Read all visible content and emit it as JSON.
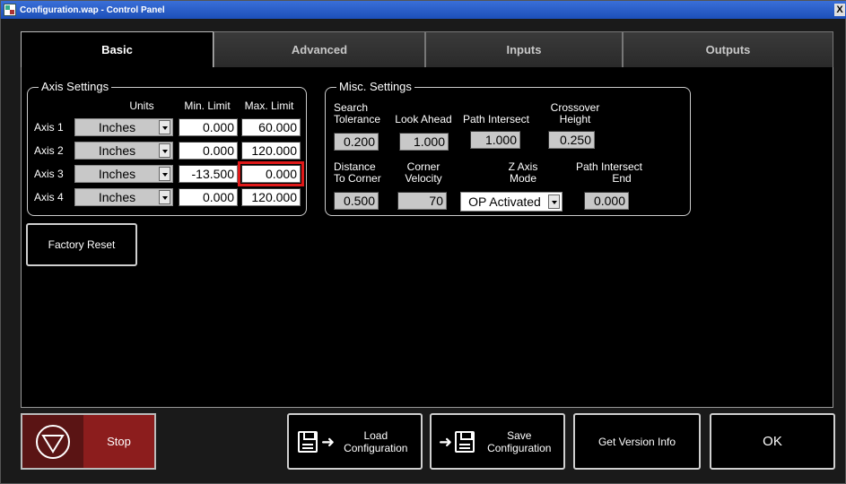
{
  "window": {
    "title": "Configuration.wap - Control Panel",
    "close_glyph": "X"
  },
  "tabs": [
    {
      "label": "Basic",
      "active": true
    },
    {
      "label": "Advanced",
      "active": false
    },
    {
      "label": "Inputs",
      "active": false
    },
    {
      "label": "Outputs",
      "active": false
    }
  ],
  "axis_settings": {
    "title": "Axis Settings",
    "headers": {
      "units": "Units",
      "min": "Min. Limit",
      "max": "Max. Limit"
    },
    "rows": [
      {
        "label": "Axis 1",
        "units": "Inches",
        "min": "0.000",
        "max": "60.000"
      },
      {
        "label": "Axis 2",
        "units": "Inches",
        "min": "0.000",
        "max": "120.000"
      },
      {
        "label": "Axis 3",
        "units": "Inches",
        "min": "-13.500",
        "max": "0.000"
      },
      {
        "label": "Axis 4",
        "units": "Inches",
        "min": "0.000",
        "max": "120.000"
      }
    ]
  },
  "misc_settings": {
    "title": "Misc. Settings",
    "search_tolerance": {
      "label1": "Search",
      "label2": "Tolerance",
      "value": "0.200"
    },
    "look_ahead": {
      "label": "Look Ahead",
      "value": "1.000"
    },
    "path_intersect": {
      "label": "Path Intersect",
      "value": "1.000"
    },
    "crossover_height": {
      "label1": "Crossover",
      "label2": "Height",
      "value": "0.250"
    },
    "distance_to_corner": {
      "label1": "Distance",
      "label2": "To Corner",
      "value": "0.500"
    },
    "corner_velocity": {
      "label1": "Corner",
      "label2": "Velocity",
      "value": "70"
    },
    "z_axis_mode": {
      "label1": "Z Axis",
      "label2": "Mode",
      "value": "OP Activated"
    },
    "path_intersect_end": {
      "label1": "Path Intersect",
      "label2": "End",
      "value": "0.000"
    }
  },
  "factory_reset_label": "Factory Reset",
  "bottom": {
    "stop_label": "Stop",
    "load_line1": "Load",
    "load_line2": "Configuration",
    "save_line1": "Save",
    "save_line2": "Configuration",
    "version_label": "Get Version Info",
    "ok_label": "OK"
  },
  "colors": {
    "stop_red": "#8c1d1d",
    "highlight": "#e01818",
    "title_blue": "#2a5fcc"
  }
}
